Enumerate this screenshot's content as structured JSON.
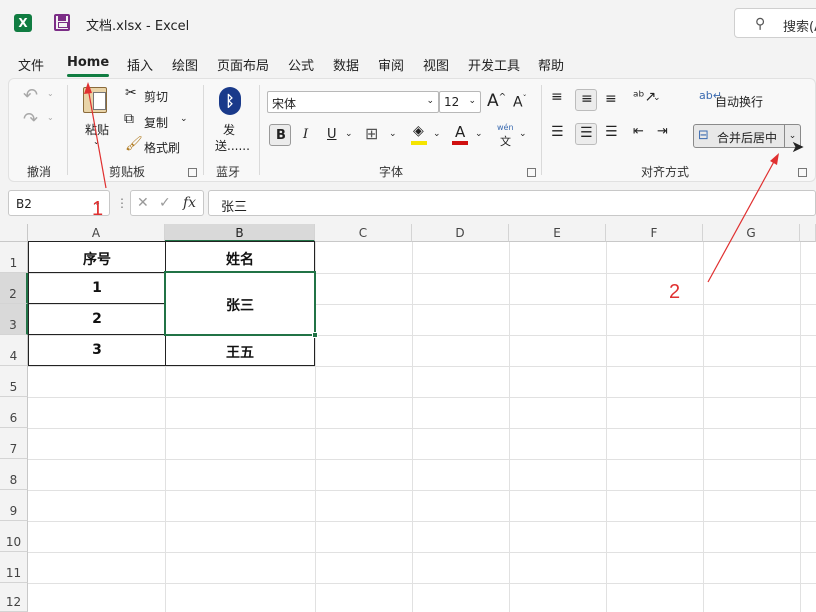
{
  "titlebar": {
    "doc_title": "文档.xlsx  -  Excel",
    "search_label": "搜索(A"
  },
  "menu": {
    "tabs": [
      "文件",
      "Home",
      "插入",
      "绘图",
      "页面布局",
      "公式",
      "数据",
      "审阅",
      "视图",
      "开发工具",
      "帮助"
    ],
    "active": "Home"
  },
  "ribbon": {
    "undo_group": "撤消",
    "clipboard": {
      "paste": "粘贴",
      "cut": "剪切",
      "copy": "复制",
      "format_painter": "格式刷",
      "group": "剪贴板"
    },
    "bluetooth": {
      "send_line1": "发",
      "send_line2": "送......",
      "group": "蓝牙"
    },
    "font": {
      "name": "宋体",
      "size": "12",
      "group": "字体",
      "bold": "B",
      "italic": "I",
      "underline": "U",
      "phonetic_top": "wén",
      "phonetic_bottom": "文",
      "increase": "A",
      "decrease": "A"
    },
    "alignment": {
      "wrap_text": "自动换行",
      "merge_center": "合并后居中",
      "group": "对齐方式"
    }
  },
  "formula_bar": {
    "name_box": "B2",
    "fx": "fx",
    "value": "张三"
  },
  "grid": {
    "columns": [
      "A",
      "B",
      "C",
      "D",
      "E",
      "F",
      "G"
    ],
    "rows": [
      "1",
      "2",
      "3",
      "4",
      "5",
      "6",
      "7",
      "8",
      "9",
      "10",
      "11",
      "12"
    ],
    "selected_column": "B",
    "cells": {
      "A1": "序号",
      "B1": "姓名",
      "A2": "1",
      "A3": "2",
      "B2": "张三",
      "A4": "3",
      "B4": "王五"
    }
  },
  "annotations": {
    "marker_1": "1",
    "marker_2": "2"
  },
  "colors": {
    "accent": "#107c41",
    "selection": "#217346",
    "annotation": "#e03030"
  }
}
